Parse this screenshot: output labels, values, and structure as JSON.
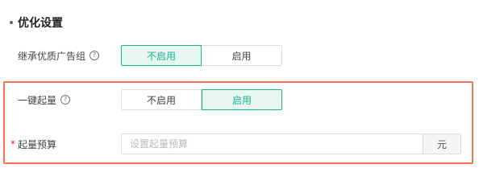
{
  "section": {
    "title": "优化设置"
  },
  "inherit": {
    "label": "继承优质广告组",
    "help_icon": "question-circle-icon",
    "options": [
      "不启用",
      "启用"
    ],
    "selected": "不启用"
  },
  "one_click": {
    "label": "一键起量",
    "help_icon": "question-circle-icon",
    "options": [
      "不启用",
      "启用"
    ],
    "selected": "启用"
  },
  "budget": {
    "required_mark": "*",
    "label": "起量预算",
    "placeholder": "设置起量预算",
    "value": "",
    "unit": "元"
  },
  "colors": {
    "accent": "#1fb38a",
    "accent_bg": "#e6f7f2",
    "highlight_border": "#f27059",
    "required": "#f5222d"
  }
}
